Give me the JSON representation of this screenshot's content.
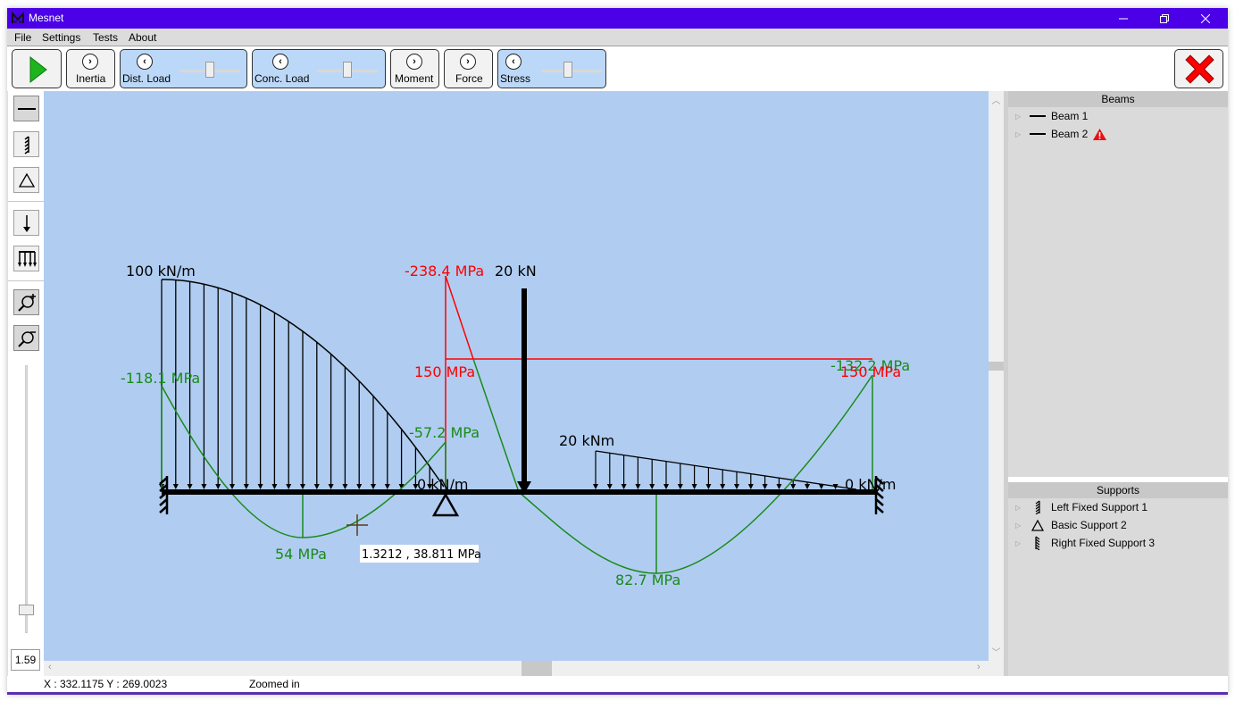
{
  "window": {
    "title": "Mesnet",
    "controls": {
      "minimize": "minimize",
      "maximize": "restore",
      "close": "close"
    }
  },
  "menu": [
    "File",
    "Settings",
    "Tests",
    "About"
  ],
  "toolbar": {
    "run_icon": "play-icon",
    "buttons": [
      {
        "label": "Inertia",
        "toggle": "chevron-right"
      },
      {
        "label": "Dist. Load",
        "toggle": "chevron-left",
        "slider": 0.55
      },
      {
        "label": "Conc. Load",
        "toggle": "chevron-left",
        "slider": 0.45
      },
      {
        "label": "Moment",
        "toggle": "chevron-right"
      },
      {
        "label": "Force",
        "toggle": "chevron-right"
      },
      {
        "label": "Stress",
        "toggle": "chevron-left",
        "slider": 0.5
      }
    ],
    "close_icon": "red-x-icon"
  },
  "left_tools": [
    {
      "name": "beam-tool",
      "icon": "beam-line-icon"
    },
    {
      "name": "fixed-support-tool",
      "icon": "fixed-support-icon"
    },
    {
      "name": "basic-support-tool",
      "icon": "triangle-support-icon"
    },
    {
      "name": "concentrated-load-tool",
      "icon": "down-arrow-icon"
    },
    {
      "name": "distributed-load-tool",
      "icon": "distributed-load-icon"
    },
    {
      "name": "zoom-in-tool",
      "icon": "zoom-in-icon"
    },
    {
      "name": "zoom-out-tool",
      "icon": "zoom-out-icon"
    }
  ],
  "zoom": {
    "value": "1.59",
    "slider_fraction": 0.1
  },
  "canvas": {
    "labels": {
      "dist_load_start": "100 kN/m",
      "dist_load_end": "0 kN/m",
      "conc_load": "20 kN",
      "moment_load_start": "20 kNm",
      "moment_load_end": "0 kN/m",
      "stress_beam1_left": "-118.1 MPa",
      "stress_beam1_right": "-57.2 MPa",
      "stress_beam1_min": "54 MPa",
      "stress_beam2_top": "-238.4 MPa",
      "stress_limit_left": "150 MPa",
      "stress_limit_right": "150 MPa",
      "stress_beam2_right": "-132.2 MPa",
      "stress_beam2_min": "82.7 MPa"
    },
    "tooltip": "1.3212 , 38.811 MPa",
    "colors": {
      "background": "#b0cdf1",
      "stress": "#1a8a1a",
      "limit": "#ff0000",
      "load": "#000000"
    }
  },
  "panels": {
    "beams": {
      "title": "Beams",
      "items": [
        {
          "label": "Beam 1",
          "warning": false
        },
        {
          "label": "Beam 2",
          "warning": true
        }
      ]
    },
    "supports": {
      "title": "Supports",
      "items": [
        {
          "label": "Left Fixed Support 1",
          "icon": "left-fixed-support-icon"
        },
        {
          "label": "Basic Support 2",
          "icon": "triangle-support-icon"
        },
        {
          "label": "Right Fixed Support 3",
          "icon": "right-fixed-support-icon"
        }
      ]
    }
  },
  "status": {
    "coords": "X : 332.1175 Y : 269.0023",
    "state": "Zoomed in"
  }
}
